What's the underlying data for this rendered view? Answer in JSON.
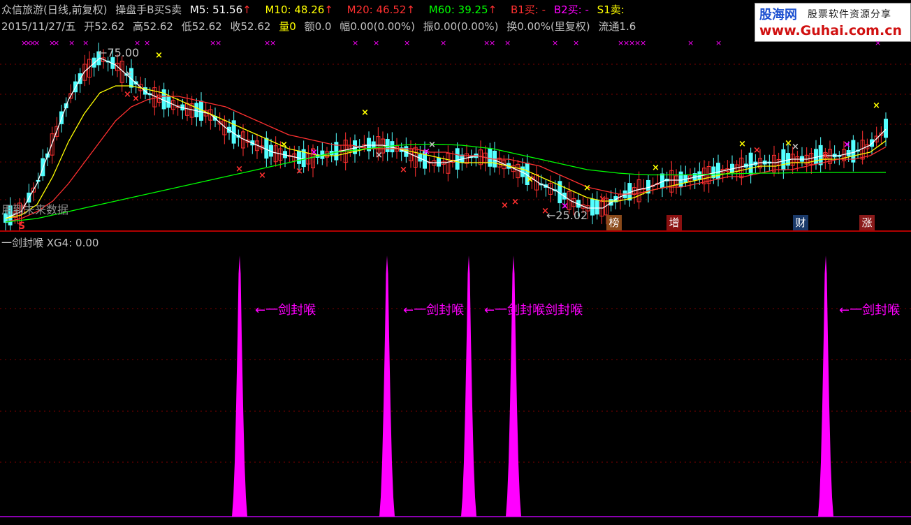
{
  "header": {
    "row1": [
      {
        "text": "众信旅游(日线,前复权)",
        "color": "#c0c0c0",
        "arrow": false
      },
      {
        "text": "操盘手B买S卖",
        "color": "#c0c0c0",
        "arrow": false
      },
      {
        "text": "M5: 51.56",
        "color": "#ffffff",
        "arrow": true
      },
      {
        "text": "M10: 48.26",
        "color": "#ffff00",
        "arrow": true
      },
      {
        "text": "M20: 46.52",
        "color": "#ff3030",
        "arrow": true
      },
      {
        "text": "M60: 39.25",
        "color": "#00ff00",
        "arrow": true
      },
      {
        "text": "B1买: -",
        "color": "#ff3030",
        "arrow": false
      },
      {
        "text": "B2买: -",
        "color": "#ff00ff",
        "arrow": false
      },
      {
        "text": "S1卖:",
        "color": "#ffff00",
        "arrow": false
      }
    ],
    "row2": [
      {
        "text": "2015/11/27/五",
        "color": "#c0c0c0"
      },
      {
        "text": "开52.62",
        "color": "#c0c0c0"
      },
      {
        "text": "高52.62",
        "color": "#c0c0c0"
      },
      {
        "text": "低52.62",
        "color": "#c0c0c0"
      },
      {
        "text": "收52.62",
        "color": "#c0c0c0"
      },
      {
        "text": "量0",
        "color": "#ffff00"
      },
      {
        "text": "额0.0",
        "color": "#c0c0c0"
      },
      {
        "text": "幅0.00(0.00%)",
        "color": "#c0c0c0"
      },
      {
        "text": "振0.00(0.00%)",
        "color": "#c0c0c0"
      },
      {
        "text": "换0.00%(里复权)",
        "color": "#c0c0c0"
      },
      {
        "text": "流通1.6",
        "color": "#c0c0c0"
      }
    ],
    "arrow_glyph": "↑",
    "arrow_color": "#ff3030"
  },
  "logo": {
    "name": "股海网",
    "slogan": "股票软件资源分享",
    "url": "www.Guhai.com.cn"
  },
  "price_chart": {
    "high_label": "75.00",
    "low_label": "25.02",
    "future_data_label": "用到未来数据",
    "sell_marker": "S",
    "events": [
      "榜",
      "增",
      "财",
      "涨"
    ],
    "event_colors": [
      "#8a4a1a",
      "#8a1010",
      "#1a3a6a",
      "#8a1a1a"
    ],
    "marker_symbol": "×"
  },
  "chart_data": {
    "type": "line",
    "title": "众信旅游(日线,前复权)",
    "ylim": [
      25,
      75
    ],
    "series": [
      {
        "name": "M5",
        "color": "#ffffff",
        "values": [
          26,
          28,
          36,
          48,
          60,
          68,
          72,
          70,
          66,
          62,
          60,
          58,
          57,
          56,
          52,
          49,
          47,
          45,
          44,
          43,
          44,
          45,
          46,
          47,
          47,
          46,
          44,
          42,
          42,
          43,
          44,
          43,
          41,
          39,
          36,
          34,
          31,
          29,
          29,
          32,
          34,
          35,
          37,
          37,
          38,
          39,
          40,
          41,
          42,
          42,
          43,
          43,
          44,
          44,
          45,
          47,
          51.56
        ]
      },
      {
        "name": "M10",
        "color": "#ffff00",
        "values": [
          26,
          27,
          30,
          38,
          48,
          56,
          62,
          64,
          64,
          63,
          62,
          60,
          58,
          56,
          54,
          52,
          50,
          48,
          46,
          45,
          44,
          44,
          45,
          46,
          46,
          46,
          45,
          44,
          43,
          42,
          42,
          42,
          41,
          40,
          38,
          36,
          34,
          32,
          31,
          31,
          32,
          34,
          35,
          36,
          37,
          38,
          39,
          40,
          41,
          41,
          42,
          42,
          43,
          43,
          44,
          45,
          48.26
        ]
      },
      {
        "name": "M20",
        "color": "#ff3030",
        "values": [
          25,
          26,
          28,
          31,
          36,
          42,
          48,
          54,
          58,
          60,
          61,
          61,
          60,
          59,
          58,
          56,
          54,
          52,
          50,
          49,
          48,
          47,
          47,
          46,
          46,
          46,
          46,
          45,
          45,
          44,
          44,
          43,
          43,
          42,
          41,
          39,
          37,
          35,
          34,
          33,
          33,
          34,
          35,
          35,
          36,
          37,
          38,
          38,
          39,
          40,
          40,
          41,
          42,
          43,
          43,
          44,
          46.52
        ]
      },
      {
        "name": "M60",
        "color": "#00ff00",
        "values": [
          25,
          25.5,
          26,
          27,
          28,
          29,
          30,
          31,
          32,
          33,
          34,
          35,
          36,
          37,
          38,
          39,
          40,
          41,
          42,
          43,
          44,
          45,
          45.5,
          46,
          46.5,
          47,
          47.2,
          47.3,
          47.2,
          47,
          46.5,
          46,
          45,
          44,
          43,
          42,
          41,
          40,
          39.5,
          39,
          38.7,
          38.5,
          38.5,
          38.5,
          38.6,
          38.7,
          38.8,
          38.9,
          39,
          39,
          39.1,
          39.1,
          39.2,
          39.2,
          39.2,
          39.2,
          39.25
        ]
      }
    ]
  },
  "indicator": {
    "name": "一剑封喉",
    "title_text": "一剑封喉  XG4: 0.00",
    "peak_label": "←一剑封喉",
    "double_peak_label": "←一剑封喉剑封喉",
    "spike_color": "#ff00ff",
    "spikes": [
      {
        "label_key": "single"
      },
      {
        "label_key": "single"
      },
      {
        "label_key": "double"
      },
      {
        "label_key": "none"
      },
      {
        "label_key": "single"
      }
    ]
  }
}
